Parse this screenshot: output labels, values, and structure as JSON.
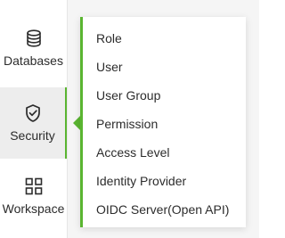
{
  "sidebar": {
    "items": [
      {
        "label": "Databases",
        "icon": "database-icon"
      },
      {
        "label": "Security",
        "icon": "shield-check-icon"
      },
      {
        "label": "Workspace",
        "icon": "grid-icon"
      }
    ],
    "active_item": "Security"
  },
  "security_menu": {
    "items": [
      "Role",
      "User",
      "User Group",
      "Permission",
      "Access Level",
      "Identity Provider",
      "OIDC Server(Open API)"
    ]
  },
  "colors": {
    "accent": "#5ab531",
    "text": "#2c2c2c",
    "active_bg": "#ededed"
  }
}
